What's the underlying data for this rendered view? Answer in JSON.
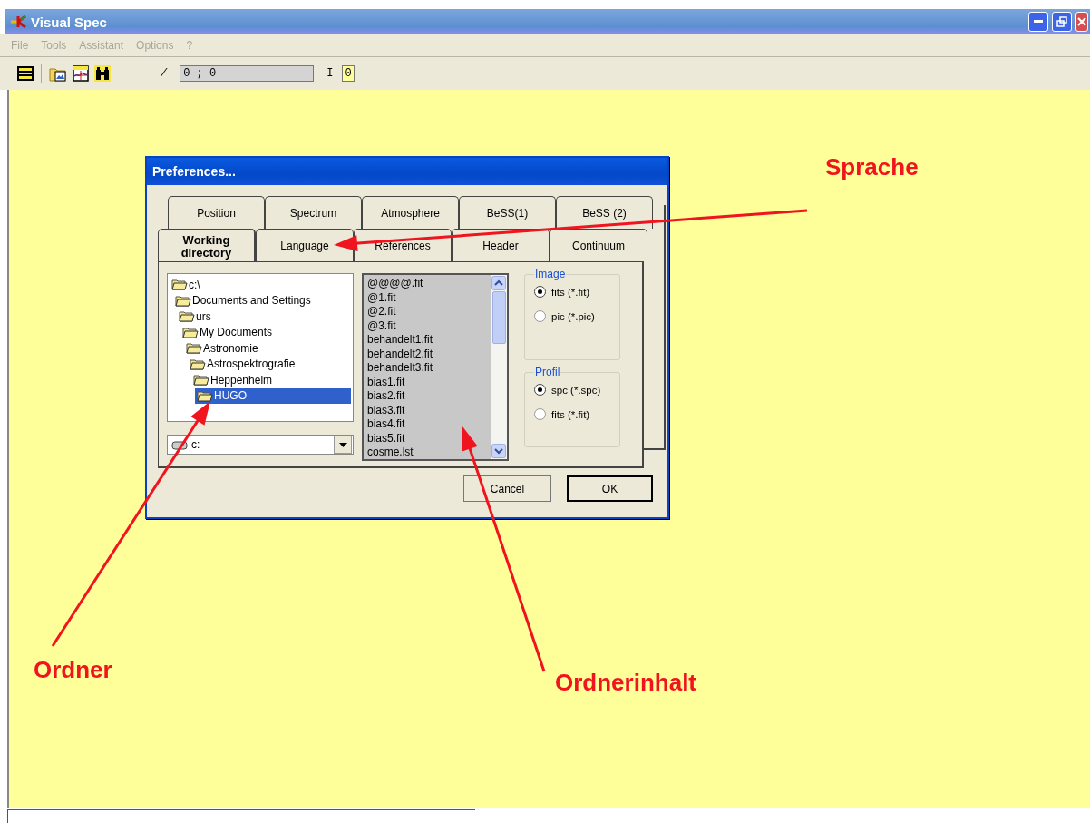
{
  "window": {
    "title": "Visual Spec"
  },
  "menu": [
    {
      "label": "File",
      "disabled": true
    },
    {
      "label": "Tools",
      "disabled": true
    },
    {
      "label": "Assistant",
      "disabled": true
    },
    {
      "label": "Options",
      "disabled": true
    },
    {
      "label": "?",
      "disabled": true
    }
  ],
  "toolbar": {
    "position_label": "/",
    "position_value": "0 ; 0",
    "intensity_label": "I",
    "intensity_value": "0"
  },
  "dialog": {
    "title": "Preferences...",
    "tab_rows": [
      [
        {
          "label": "Position",
          "selected": false
        },
        {
          "label": "Spectrum",
          "selected": false
        },
        {
          "label": "Atmosphere",
          "selected": false
        },
        {
          "label": "BeSS(1)",
          "selected": false
        },
        {
          "label": "BeSS (2)",
          "selected": false
        }
      ],
      [
        {
          "label": "Working directory",
          "selected": true
        },
        {
          "label": "Language",
          "selected": false
        },
        {
          "label": "References",
          "selected": false
        },
        {
          "label": "Header",
          "selected": false
        },
        {
          "label": "Continuum",
          "selected": false
        }
      ]
    ],
    "folder_tree": [
      {
        "label": "c:\\",
        "selected": false,
        "children": [
          {
            "label": "Documents and Settings",
            "selected": false,
            "children": [
              {
                "label": "urs",
                "selected": false,
                "children": [
                  {
                    "label": "My Documents",
                    "selected": false,
                    "children": [
                      {
                        "label": "Astronomie",
                        "selected": false,
                        "children": [
                          {
                            "label": "Astrospektrografie",
                            "selected": false,
                            "children": [
                              {
                                "label": "Heppenheim",
                                "selected": false,
                                "children": [
                                  {
                                    "label": "HUGO",
                                    "selected": true
                                  }
                                ]
                              }
                            ]
                          }
                        ]
                      }
                    ]
                  }
                ]
              }
            ]
          }
        ]
      }
    ],
    "drive": "c:",
    "files": [
      "@@@@.fit",
      "@1.fit",
      "@2.fit",
      "@3.fit",
      "behandelt1.fit",
      "behandelt2.fit",
      "behandelt3.fit",
      "bias1.fit",
      "bias2.fit",
      "bias3.fit",
      "bias4.fit",
      "bias5.fit",
      "cosme.lst"
    ],
    "groups": [
      {
        "title": "Image",
        "options": [
          {
            "label": "fits (*.fit)",
            "selected": true
          },
          {
            "label": "pic (*.pic)",
            "selected": false
          }
        ]
      },
      {
        "title": "Profil",
        "options": [
          {
            "label": "spc (*.spc)",
            "selected": true
          },
          {
            "label": "fits (*.fit)",
            "selected": false
          }
        ]
      }
    ],
    "buttons": [
      {
        "label": "Cancel",
        "default": false
      },
      {
        "label": "OK",
        "default": true
      }
    ]
  },
  "annotations": [
    {
      "label": "Sprache"
    },
    {
      "label": "Ordner"
    },
    {
      "label": "Ordnerinhalt"
    }
  ]
}
